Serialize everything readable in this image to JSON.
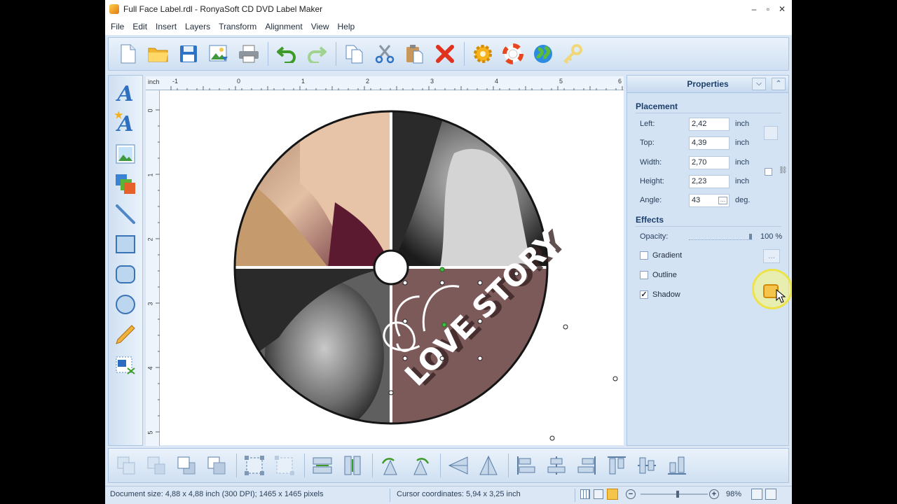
{
  "window": {
    "title": "Full Face Label.rdl - RonyaSoft CD DVD Label Maker",
    "minimize": "–",
    "maximize": "▫",
    "close": "✕"
  },
  "menu": [
    "File",
    "Edit",
    "Insert",
    "Layers",
    "Transform",
    "Alignment",
    "View",
    "Help"
  ],
  "toolbar": [
    "new-document-icon",
    "open-folder-icon",
    "save-icon",
    "export-image-icon",
    "print-icon",
    "undo-icon",
    "redo-icon",
    "copy-icon",
    "cut-icon",
    "paste-icon",
    "delete-icon",
    "settings-icon",
    "help-icon",
    "web-icon",
    "key-icon"
  ],
  "left_tools": [
    "insert-text",
    "insert-curved-text",
    "insert-image",
    "insert-layered-image",
    "draw-line",
    "draw-rectangle",
    "draw-rounded-rectangle",
    "draw-ellipse",
    "draw-freehand",
    "insert-track-list"
  ],
  "ruler": {
    "unit": "inch",
    "top_labels": [
      "-1",
      "0",
      "1",
      "2",
      "3",
      "4",
      "5",
      "6"
    ],
    "left_labels": [
      "0",
      "1",
      "2",
      "3",
      "4",
      "5"
    ]
  },
  "canvas": {
    "art_text": "LOVE STORY"
  },
  "properties": {
    "title": "Properties",
    "placement_title": "Placement",
    "left": {
      "label": "Left:",
      "value": "2,42",
      "unit": "inch"
    },
    "top": {
      "label": "Top:",
      "value": "4,39",
      "unit": "inch"
    },
    "width": {
      "label": "Width:",
      "value": "2,70",
      "unit": "inch"
    },
    "height": {
      "label": "Height:",
      "value": "2,23",
      "unit": "inch"
    },
    "angle": {
      "label": "Angle:",
      "value": "43",
      "unit": "deg."
    },
    "effects_title": "Effects",
    "opacity": {
      "label": "Opacity:",
      "value": "100 %",
      "level": 1.0
    },
    "gradient": {
      "label": "Gradient",
      "checked": false
    },
    "outline": {
      "label": "Outline",
      "checked": false
    },
    "shadow": {
      "label": "Shadow",
      "checked": true
    },
    "more_button": "..."
  },
  "bottom_tools": [
    "group",
    "ungroup",
    "bring-to-front",
    "send-to-back",
    "fit-to-canvas",
    "fit-proportional",
    "same-width",
    "same-height",
    "rotate-left",
    "rotate-right",
    "flip-vertical",
    "flip-horizontal",
    "align-left",
    "align-center",
    "align-right",
    "align-top",
    "align-middle",
    "align-bottom"
  ],
  "status": {
    "document_size": "Document size: 4,88 x 4,88 inch (300 DPI); 1465 x 1465 pixels",
    "cursor": "Cursor coordinates: 5,94 x 3,25 inch",
    "zoom": "98%",
    "zoom_level": 0.55
  },
  "colors": {
    "accent": "#2e6fc0",
    "panel": "#d3e3f4",
    "label_bg": "#7d5a5a"
  }
}
